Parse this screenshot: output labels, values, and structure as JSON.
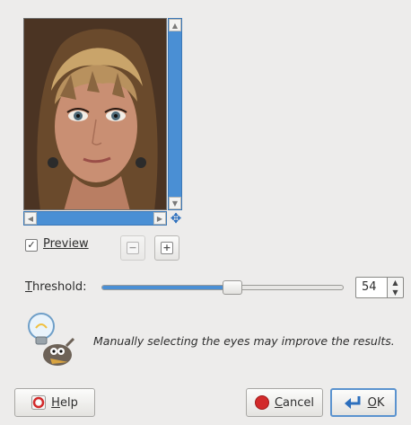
{
  "preview": {
    "checkbox_checked": true,
    "checkbox_mark": "✓",
    "label_mnemonic": "P",
    "label_rest": "review",
    "image_icon": "portrait-photo",
    "navigate_icon": "✥",
    "zoom_out_icon": "−",
    "zoom_in_icon": "+"
  },
  "threshold": {
    "label_mnemonic": "T",
    "label_rest": "hreshold:",
    "value": "54",
    "slider_fraction": 0.54,
    "up_arrow": "▲",
    "down_arrow": "▼"
  },
  "hint": {
    "icon": "wilber-lightbulb-icon",
    "text": "Manually selecting the eyes may improve the results."
  },
  "buttons": {
    "help_mnemonic": "H",
    "help_rest": "elp",
    "cancel_mnemonic": "C",
    "cancel_rest": "ancel",
    "ok_mnemonic": "O",
    "ok_rest": "K"
  },
  "colors": {
    "accent": "#4a8fd4",
    "cancel_red": "#d22a2a",
    "ok_blue": "#2c6fbd"
  }
}
